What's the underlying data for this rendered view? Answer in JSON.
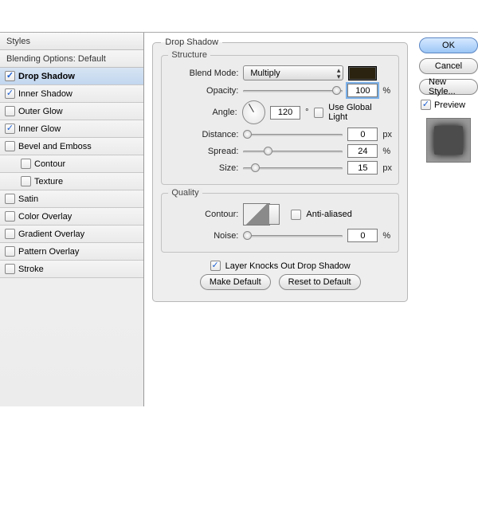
{
  "sidebar": {
    "header": "Styles",
    "blending": "Blending Options: Default",
    "items": [
      {
        "label": "Drop Shadow",
        "checked": true,
        "active": true
      },
      {
        "label": "Inner Shadow",
        "checked": true
      },
      {
        "label": "Outer Glow",
        "checked": false
      },
      {
        "label": "Inner Glow",
        "checked": true
      },
      {
        "label": "Bevel and Emboss",
        "checked": false
      },
      {
        "label": "Contour",
        "checked": false,
        "sub": true
      },
      {
        "label": "Texture",
        "checked": false,
        "sub": true
      },
      {
        "label": "Satin",
        "checked": false
      },
      {
        "label": "Color Overlay",
        "checked": false
      },
      {
        "label": "Gradient Overlay",
        "checked": false
      },
      {
        "label": "Pattern Overlay",
        "checked": false
      },
      {
        "label": "Stroke",
        "checked": false
      }
    ]
  },
  "panel": {
    "title": "Drop Shadow",
    "structure_label": "Structure",
    "blend_mode_label": "Blend Mode:",
    "blend_mode_value": "Multiply",
    "opacity_label": "Opacity:",
    "opacity_value": "100",
    "opacity_unit": "%",
    "angle_label": "Angle:",
    "angle_value": "120",
    "angle_unit": "°",
    "use_global_label": "Use Global Light",
    "use_global_checked": false,
    "distance_label": "Distance:",
    "distance_value": "0",
    "distance_unit": "px",
    "spread_label": "Spread:",
    "spread_value": "24",
    "spread_unit": "%",
    "size_label": "Size:",
    "size_value": "15",
    "size_unit": "px",
    "quality_label": "Quality",
    "contour_label": "Contour:",
    "anti_alias_label": "Anti-aliased",
    "noise_label": "Noise:",
    "noise_value": "0",
    "noise_unit": "%",
    "knocks_out_label": "Layer Knocks Out Drop Shadow",
    "make_default": "Make Default",
    "reset_default": "Reset to Default",
    "color_swatch": "#2b230f"
  },
  "buttons": {
    "ok": "OK",
    "cancel": "Cancel",
    "new_style": "New Style...",
    "preview": "Preview"
  }
}
